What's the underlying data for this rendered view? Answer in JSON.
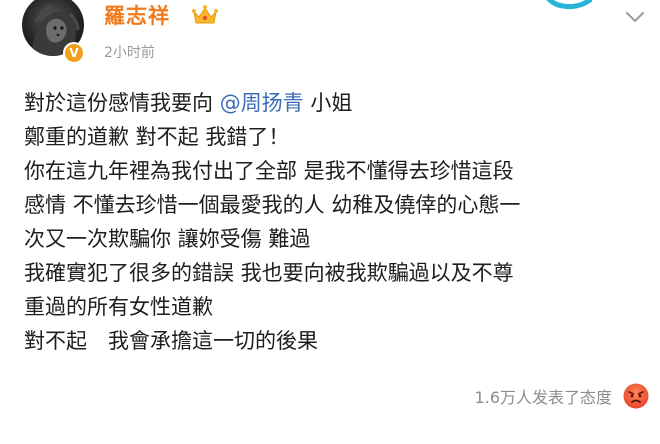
{
  "user": {
    "name": "羅志祥",
    "time": "2小时前",
    "badge_icon": "verified-v-icon",
    "crown_icon": "crown-icon",
    "colors": {
      "name": "#f07b1c",
      "badge": "#f29f1f"
    }
  },
  "post": {
    "line1_prefix": "對於這份感情我要向 ",
    "mention": "@周扬青",
    "line1_suffix": " 小姐",
    "lines": [
      "鄭重的道歉 對不起 我錯了！",
      "你在這九年裡為我付出了全部 是我不懂得去珍惜這段",
      "感情 不懂去珍惜一個最愛我的人 幼稚及僥倖的心態一",
      "次又一次欺騙你 讓妳受傷 難過",
      "我確實犯了很多的錯誤 我也要向被我欺騙過以及不尊",
      "重過的所有女性道歉",
      "對不起　我會承擔這一切的後果"
    ],
    "mention_color": "#3b6bb5"
  },
  "footer": {
    "reaction_text": "1.6万人发表了态度",
    "reaction_icon": "angry-face-icon"
  }
}
